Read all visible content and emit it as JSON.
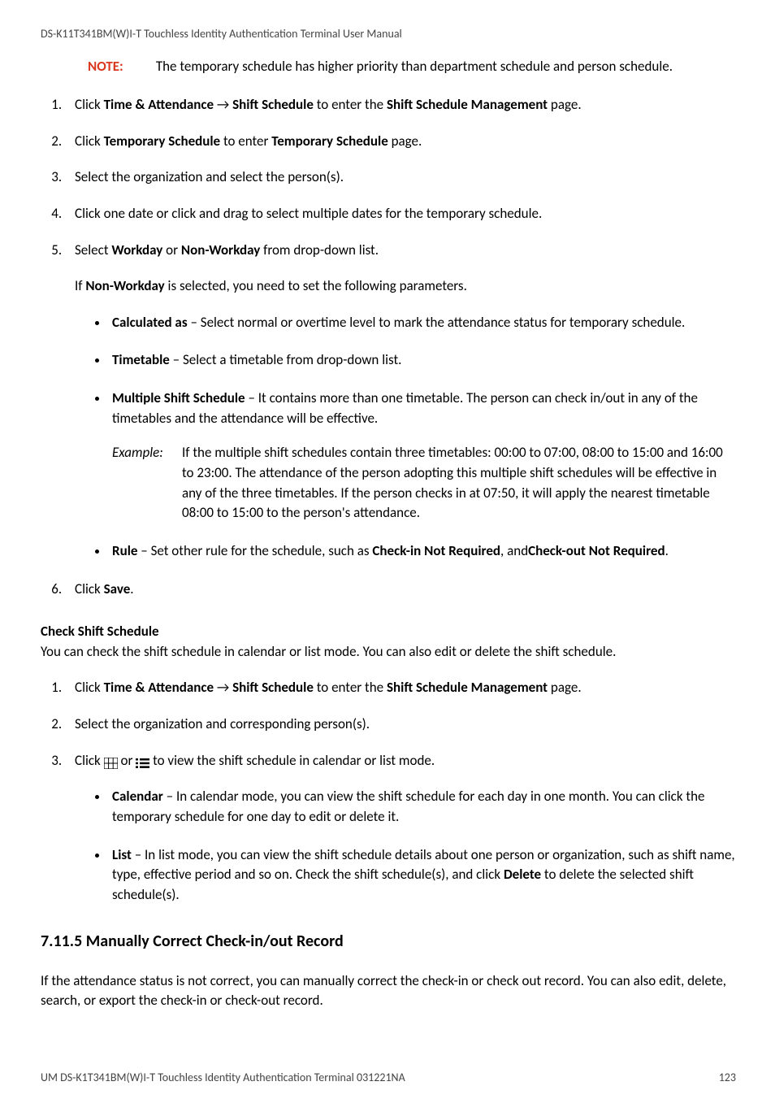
{
  "header": "DS-K11T341BM(W)I-T Touchless Identity Authentication Terminal User Manual",
  "note": {
    "label": "NOTE:",
    "text": "The temporary schedule has higher priority than department schedule and person schedule."
  },
  "list1": {
    "i1": {
      "pre": "Click ",
      "b1": "Time & Attendance",
      "arrow": " → ",
      "b2": "Shift Schedule",
      "mid": " to enter the ",
      "b3": "Shift Schedule Management",
      "post": " page."
    },
    "i2": {
      "pre": "Click ",
      "b1": "Temporary Schedule",
      "mid": " to enter ",
      "b2": "Temporary Schedule",
      "post": " page."
    },
    "i3": "Select the organization and select the person(s).",
    "i4": "Click one date or click and drag to select multiple dates for the temporary schedule.",
    "i5": {
      "pre": "Select ",
      "b1": "Workday",
      "or": " or ",
      "b2": "Non-Workday",
      "post": " from drop-down list."
    },
    "i5sub": {
      "pre": "If ",
      "b1": "Non-Workday",
      "post": " is selected, you need to set the following parameters."
    },
    "i6": {
      "pre": "Click ",
      "b1": "Save",
      "post": "."
    }
  },
  "bullets1": {
    "b1": {
      "title": "Calculated as",
      "text": " – Select normal or overtime level to mark the attendance status for temporary schedule."
    },
    "b2": {
      "title": "Timetable",
      "text": " – Select a timetable from drop-down list."
    },
    "b3": {
      "title": "Multiple Shift Schedule",
      "text": " – It contains more than one timetable. The person can check in/out in any of the timetables and the attendance will be effective."
    },
    "b4": {
      "title": "Rule",
      "pre": " – Set other rule for the schedule, such as ",
      "b1": "Check-in Not Required",
      "mid": ", and",
      "b2": "Check-out Not Required",
      "post": "."
    }
  },
  "example": {
    "label": "Example:",
    "text": "If the multiple shift schedules contain three timetables: 00:00 to 07:00, 08:00 to 15:00 and 16:00 to 23:00. The attendance of the person adopting this multiple shift schedules will be effective in any of the three timetables. If the person checks in at 07:50, it will apply the nearest timetable 08:00 to 15:00 to the person's attendance."
  },
  "check": {
    "title": "Check Shift Schedule",
    "desc": "You can check the shift schedule in calendar or list mode. You can also edit or delete the shift schedule."
  },
  "list2": {
    "i1": {
      "pre": "Click ",
      "b1": "Time & Attendance",
      "arrow": " → ",
      "b2": "Shift Schedule",
      "mid": " to enter the ",
      "b3": "Shift Schedule Management",
      "post": " page."
    },
    "i2": "Select the organization and corresponding person(s).",
    "i3": {
      "pre": "Click  ",
      "or": "  or  ",
      "post": "  to view the shift schedule in calendar or list mode."
    }
  },
  "bullets2": {
    "b1": {
      "title": "Calendar",
      "text": " – In calendar mode, you can view the shift schedule for each day in one month. You can click the temporary schedule for one day to edit or delete it."
    },
    "b2": {
      "title": "List",
      "pre": " – In list mode, you can view the shift schedule details about one person or organization, such as shift name, type, effective period and so on. Check the shift schedule(s), and click ",
      "b1": "Delete",
      "post": " to delete the selected shift schedule(s)."
    }
  },
  "h3": "7.11.5 Manually Correct Check-in/out Record",
  "h3desc": "If the attendance status is not correct, you can manually correct the check-in or check out record. You can also edit, delete, search, or export the check-in or check-out record.",
  "footer": {
    "left": "UM DS-K1T341BM(W)I-T Touchless Identity Authentication Terminal 031221NA",
    "right": "123"
  }
}
